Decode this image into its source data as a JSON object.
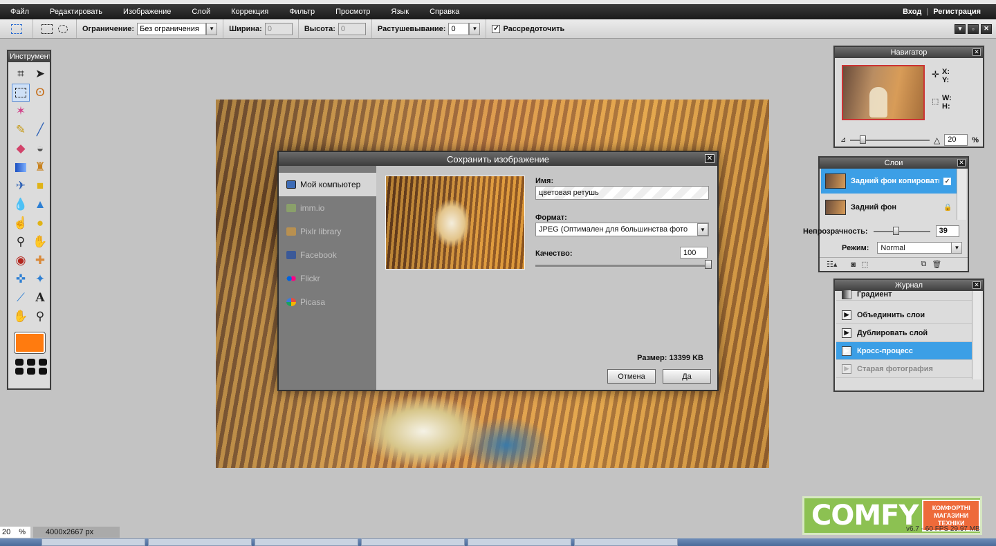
{
  "menu": {
    "items": [
      "Файл",
      "Редактировать",
      "Изображение",
      "Слой",
      "Коррекция",
      "Фильтр",
      "Просмотр",
      "Язык",
      "Справка"
    ],
    "login": "Вход",
    "register": "Регистрация"
  },
  "options": {
    "limit_label": "Ограничение:",
    "limit_value": "Без ограничения",
    "width_label": "Ширина:",
    "width_value": "0",
    "height_label": "Высота:",
    "height_value": "0",
    "feather_label": "Растушевывание:",
    "feather_value": "0",
    "antialias_label": "Рассредоточить",
    "antialias_checked": true
  },
  "tools": {
    "title": "Инструменты",
    "foreground_color": "#ff7b0f"
  },
  "navigator": {
    "title": "Навигатор",
    "x_label": "X:",
    "y_label": "Y:",
    "w_label": "W:",
    "h_label": "H:",
    "zoom": "20",
    "zoom_unit": "%"
  },
  "layers": {
    "title": "Слои",
    "items": [
      {
        "name": "Задний фон копировать",
        "active": true
      },
      {
        "name": "Задний фон",
        "active": false
      }
    ],
    "opacity_label": "Непрозрачность:",
    "opacity_value": "39",
    "mode_label": "Режим:",
    "mode_value": "Normal"
  },
  "history": {
    "title": "Журнал",
    "items": [
      {
        "label": "Градиент",
        "state": "normal"
      },
      {
        "label": "Объединить слои",
        "state": "normal"
      },
      {
        "label": "Дублировать слой",
        "state": "normal"
      },
      {
        "label": "Кросс-процесс",
        "state": "active"
      },
      {
        "label": "Старая фотография",
        "state": "dim"
      }
    ]
  },
  "dialog": {
    "title": "Сохранить изображение",
    "destinations": [
      "Мой компьютер",
      "imm.io",
      "Pixlr library",
      "Facebook",
      "Flickr",
      "Picasa"
    ],
    "name_label": "Имя:",
    "name_value": "цветовая ретушь",
    "format_label": "Формат:",
    "format_value": "JPEG (Оптимален для большинства фото",
    "quality_label": "Качество:",
    "quality_value": "100",
    "size_text": "Размер: 13399 KB",
    "cancel_label": "Отмена",
    "ok_label": "Да"
  },
  "status": {
    "zoom": "20",
    "zoom_unit": "%",
    "dimensions": "4000x2667 px",
    "fps": "v6.7 - 60 FPS 29.97 MB"
  },
  "logo": {
    "word": "COMFY",
    "tagline": "КОМФОРТНІ МАГАЗИНИ ТЕХНІКИ"
  }
}
